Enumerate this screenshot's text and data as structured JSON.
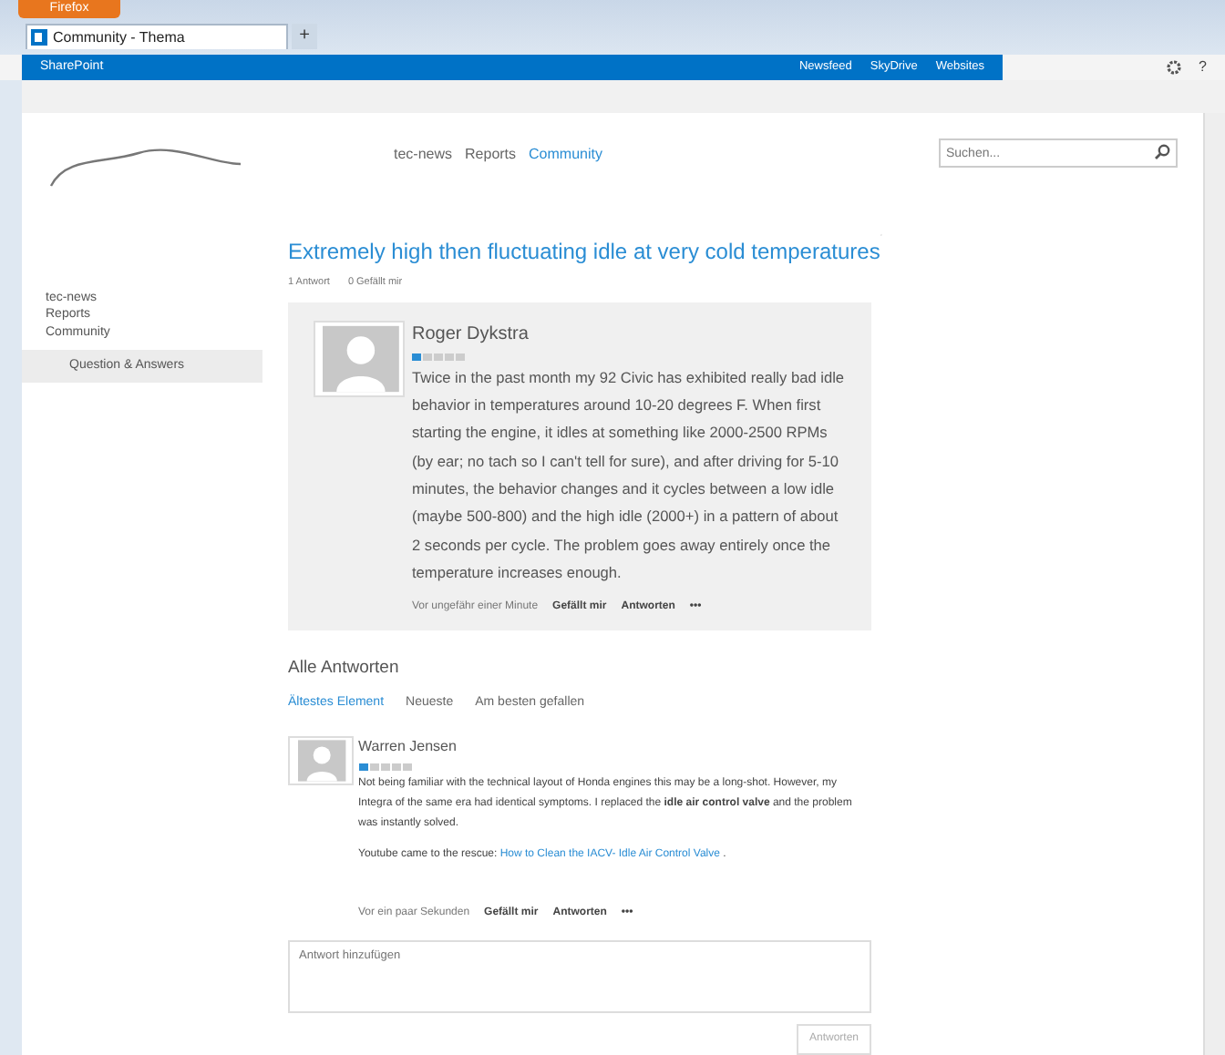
{
  "browser": {
    "app_button": "Firefox",
    "tab_title": "Community - Thema",
    "new_tab": "+"
  },
  "suite_bar": {
    "brand": "SharePoint",
    "links": [
      "Newsfeed",
      "SkyDrive",
      "Websites"
    ],
    "help": "?"
  },
  "header": {
    "nav": [
      {
        "label": "tec-news",
        "selected": false
      },
      {
        "label": "Reports",
        "selected": false
      },
      {
        "label": "Community",
        "selected": true
      }
    ],
    "search": {
      "placeholder": "Suchen..."
    }
  },
  "sidebar": {
    "items": [
      {
        "label": "tec-news",
        "selected": false
      },
      {
        "label": "Reports",
        "selected": false
      },
      {
        "label": "Community",
        "selected": false
      },
      {
        "label": "Question & Answers",
        "selected": true
      }
    ]
  },
  "thread": {
    "title": "Extremely high then fluctuating idle at very cold temperatures",
    "meta": [
      "1 Antwort",
      "0 Gefällt mir"
    ],
    "post": {
      "author": "Roger Dykstra",
      "stars": 1,
      "body": "Twice in the past month my 92 Civic has exhibited really bad idle behavior in temperatures around 10-20 degrees F. When first starting the engine, it idles at something like 2000-2500 RPMs (by ear; no tach so I can't tell for sure), and after driving for 5-10 minutes, the behavior changes and it cycles between a low idle (maybe 500-800) and the high idle (2000+) in a pattern of about 2 seconds per cycle. The problem goes away entirely once the temperature increases enough.",
      "time": "Vor ungefähr einer Minute",
      "actions": [
        "Gefällt mir",
        "Antworten",
        "•••"
      ]
    }
  },
  "replies": {
    "heading": "Alle Antworten",
    "sort_tabs": [
      {
        "label": "Ältestes Element",
        "selected": true
      },
      {
        "label": "Neueste",
        "selected": false
      },
      {
        "label": "Am besten gefallen",
        "selected": false
      }
    ],
    "items": [
      {
        "author": "Warren Jensen",
        "stars": 1,
        "body": "Not being familiar with the technical layout of Honda engines this may be a long-shot. However, my Integra of the same era had identical symptoms. I replaced the **idle air control valve** and the problem was instantly solved.",
        "link_prefix": "Youtube came to the rescue: ",
        "link": "How to Clean the IACV- Idle Air Control Valve",
        "link_suffix": " .",
        "time": "Vor ein paar Sekunden",
        "actions": [
          "Gefällt mir",
          "Antworten",
          "•••"
        ]
      }
    ],
    "compose": {
      "placeholder": "Antwort hinzufügen",
      "button": "Antworten",
      "disabled": true
    }
  }
}
